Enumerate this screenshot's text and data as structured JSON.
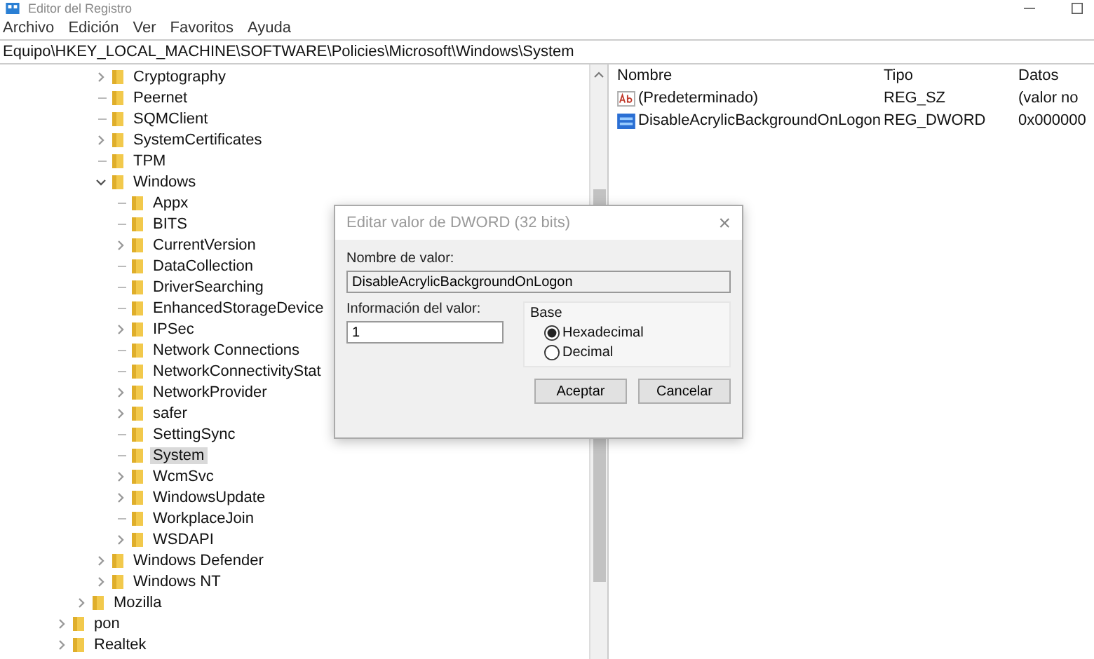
{
  "window": {
    "title": "Editor del Registro"
  },
  "menu": [
    "Archivo",
    "Edición",
    "Ver",
    "Favoritos",
    "Ayuda"
  ],
  "address": "Equipo\\HKEY_LOCAL_MACHINE\\SOFTWARE\\Policies\\Microsoft\\Windows\\System",
  "tree": [
    {
      "children": [
        {
          "children": [
            {
              "label": "Cryptography",
              "expanded": false,
              "selected": false
            },
            {
              "label": "Peernet",
              "selected": false
            },
            {
              "label": "SQMClient",
              "selected": false
            },
            {
              "label": "SystemCertificates",
              "expanded": false,
              "selected": false
            },
            {
              "label": "TPM",
              "selected": false
            },
            {
              "label": "Windows",
              "expanded": true,
              "selected": false,
              "children": [
                {
                  "label": "Appx",
                  "selected": false
                },
                {
                  "label": "BITS",
                  "selected": false
                },
                {
                  "label": "CurrentVersion",
                  "expanded": false,
                  "selected": false
                },
                {
                  "label": "DataCollection",
                  "selected": false
                },
                {
                  "label": "DriverSearching",
                  "selected": false
                },
                {
                  "label": "EnhancedStorageDevice",
                  "selected": false
                },
                {
                  "label": "IPSec",
                  "expanded": false,
                  "selected": false
                },
                {
                  "label": "Network Connections",
                  "selected": false
                },
                {
                  "label": "NetworkConnectivityStat",
                  "selected": false
                },
                {
                  "label": "NetworkProvider",
                  "expanded": false,
                  "selected": false
                },
                {
                  "label": "safer",
                  "expanded": false,
                  "selected": false
                },
                {
                  "label": "SettingSync",
                  "selected": false
                },
                {
                  "label": "System",
                  "selected": true
                },
                {
                  "label": "WcmSvc",
                  "expanded": false,
                  "selected": false
                },
                {
                  "label": "WindowsUpdate",
                  "expanded": false,
                  "selected": false
                },
                {
                  "label": "WorkplaceJoin",
                  "selected": false
                },
                {
                  "label": "WSDAPI",
                  "expanded": false,
                  "selected": false
                }
              ]
            },
            {
              "label": "Windows Defender",
              "expanded": false,
              "selected": false
            },
            {
              "label": "Windows NT",
              "expanded": false,
              "selected": false
            }
          ]
        },
        {
          "label": "Mozilla",
          "expanded": false,
          "selected": false
        }
      ]
    },
    {
      "label": "pon",
      "expanded": false,
      "selected": false
    },
    {
      "label": "Realtek",
      "expanded": false,
      "selected": false
    }
  ],
  "values": {
    "columns": [
      "Nombre",
      "Tipo",
      "Datos"
    ],
    "rows": [
      {
        "kind": "string",
        "name": "(Predeterminado)",
        "type": "REG_SZ",
        "data": "(valor no"
      },
      {
        "kind": "binary",
        "name": "DisableAcrylicBackgroundOnLogon",
        "type": "REG_DWORD",
        "data": "0x000000"
      }
    ]
  },
  "dialog": {
    "title": "Editar valor de DWORD (32 bits)",
    "close": "×",
    "name_label": "Nombre de valor:",
    "name_value": "DisableAcrylicBackgroundOnLogon",
    "data_label": "Información del valor:",
    "data_value": "1",
    "base_label": "Base",
    "bases": [
      {
        "label": "Hexadecimal",
        "selected": true
      },
      {
        "label": "Decimal",
        "selected": false
      }
    ],
    "buttons": [
      "Aceptar",
      "Cancelar"
    ]
  }
}
